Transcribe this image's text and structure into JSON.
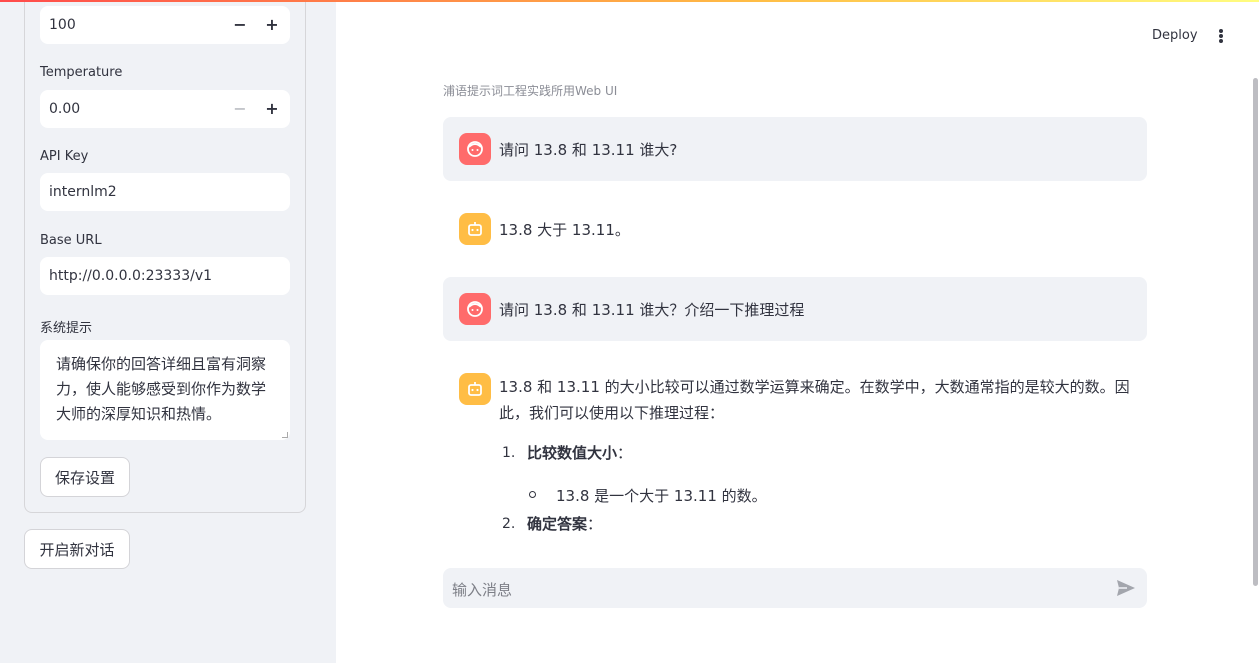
{
  "sidebar": {
    "max_tokens_value": "100",
    "temperature_label": "Temperature",
    "temperature_value": "0.00",
    "api_key_label": "API Key",
    "api_key_value": "internlm2",
    "base_url_label": "Base URL",
    "base_url_value": "http://0.0.0.0:23333/v1",
    "system_prompt_label": "系统提示",
    "system_prompt_value": "请确保你的回答详细且富有洞察力，使人能够感受到你作为数学大师的深厚知识和热情。",
    "save_button": "保存设置",
    "new_chat_button": "开启新对话",
    "minus": "−",
    "plus": "+"
  },
  "header": {
    "deploy_label": "Deploy",
    "menu_icon": "kebab-menu-icon"
  },
  "main": {
    "caption": "浦语提示词工程实践所用Web UI",
    "messages": [
      {
        "role": "user",
        "text": "请问 13.8 和 13.11 谁大?"
      },
      {
        "role": "assistant",
        "text": "13.8 大于 13.11。"
      },
      {
        "role": "user",
        "text": "请问 13.8 和 13.11 谁大？介绍一下推理过程"
      },
      {
        "role": "assistant",
        "paragraph": "13.8 和 13.11 的大小比较可以通过数学运算来确定。在数学中，大数通常指的是较大的数。因此，我们可以使用以下推理过程：",
        "list": [
          {
            "num": "1.",
            "title": "比较数值大小",
            "suffix": "：",
            "sub": "13.8 是一个大于 13.11 的数。"
          },
          {
            "num": "2.",
            "title": "确定答案",
            "suffix": "："
          }
        ]
      }
    ],
    "chat_input_placeholder": "输入消息"
  },
  "colors": {
    "user_avatar": "#ff6b6b",
    "assistant_avatar": "#ffbd45",
    "sidebar_bg": "#f0f2f6"
  }
}
